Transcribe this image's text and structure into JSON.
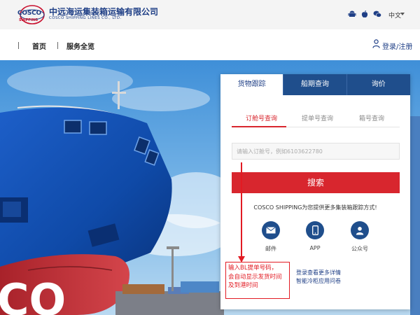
{
  "header": {
    "logo_text": "COSCO",
    "logo_sub": "SHIPPING",
    "company_cn": "中远海运集装箱运输有限公司",
    "company_en": "COSCO SHIPPING LINES CO., LTD.",
    "platform_icons": [
      "android-icon",
      "apple-icon",
      "wechat-icon"
    ],
    "language": "中文"
  },
  "nav": {
    "items": [
      {
        "label": "首页"
      },
      {
        "label": "服务全览"
      }
    ],
    "login": "登录/注册"
  },
  "panel": {
    "tabs": [
      {
        "label": "货物跟踪",
        "active": true
      },
      {
        "label": "船期查询",
        "active": false
      },
      {
        "label": "询价",
        "active": false
      }
    ],
    "subtabs": [
      {
        "label": "订舱号查询",
        "active": true
      },
      {
        "label": "提单号查询",
        "active": false
      },
      {
        "label": "箱号查询",
        "active": false
      }
    ],
    "search_placeholder": "请输入订舱号，例如6103622780",
    "search_button": "搜索",
    "contact_title": "COSCO SHIPPING为您提供更多集装箱跟踪方式!",
    "contacts": [
      {
        "label": "邮件",
        "icon": "envelope-icon"
      },
      {
        "label": "APP",
        "icon": "phone-icon"
      },
      {
        "label": "公众号",
        "icon": "person-icon"
      }
    ],
    "links": [
      "登录查看更多详情",
      "智能冷柜应用问卷"
    ]
  },
  "annotation": {
    "text_lines": [
      "输入BL提单号码，",
      "会自动显示发货时间",
      "及到港时间"
    ]
  },
  "colors": {
    "brand_blue": "#1f4e8c",
    "accent_red": "#d8262e",
    "annotation_red": "#e21b23"
  }
}
